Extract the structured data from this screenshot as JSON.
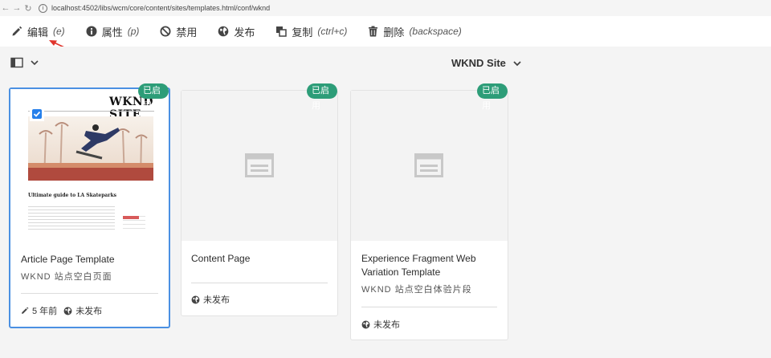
{
  "browser": {
    "url": "localhost:4502/libs/wcm/core/content/sites/templates.html/conf/wknd"
  },
  "toolbar": {
    "edit_label": "编辑",
    "edit_hint": "(e)",
    "properties_label": "属性",
    "properties_hint": "(p)",
    "disable_label": "禁用",
    "publish_label": "发布",
    "copy_label": "复制",
    "copy_hint": "(ctrl+c)",
    "delete_label": "删除",
    "delete_hint": "(backspace)"
  },
  "viewbar": {
    "site_name": "WKND Site"
  },
  "cards": [
    {
      "status_badge": "已启用",
      "title": "Article Page Template",
      "subtitle": "WKND 站点空白页面",
      "modified": "5 年前",
      "publish_status": "未发布",
      "thumb": {
        "brand": "WKND SITE",
        "headline": "Ultimate guide to LA Skateparks"
      }
    },
    {
      "status_badge": "已启用",
      "title": "Content Page",
      "publish_status": "未发布"
    },
    {
      "status_badge": "已启用",
      "title": "Experience Fragment Web Variation Template",
      "subtitle": "WKND 站点空白体验片段",
      "publish_status": "未发布"
    }
  ],
  "colors": {
    "badge": "#2d9d78",
    "selection": "#4b90e2",
    "checkbox": "#2680eb",
    "annotation_arrow": "#e0342c"
  }
}
